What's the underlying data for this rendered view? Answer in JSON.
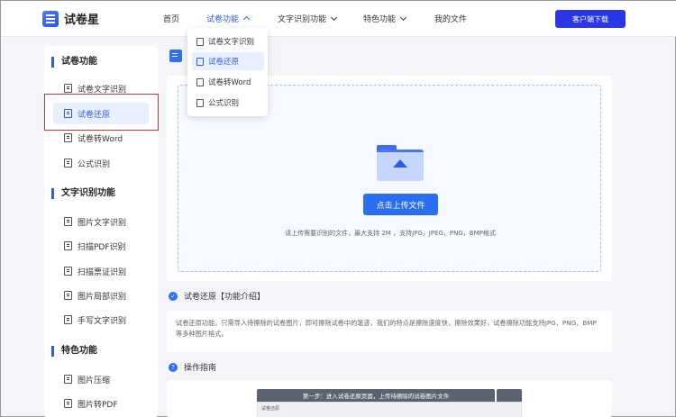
{
  "header": {
    "logo_text": "试卷星",
    "nav": [
      {
        "label": "首页",
        "active": false,
        "chevron": "none"
      },
      {
        "label": "试卷功能",
        "active": true,
        "chevron": "up"
      },
      {
        "label": "文字识别功能",
        "active": false,
        "chevron": "down"
      },
      {
        "label": "特色功能",
        "active": false,
        "chevron": "down"
      },
      {
        "label": "我的文件",
        "active": false,
        "chevron": "none"
      }
    ],
    "download_label": "客户端下载"
  },
  "dropdown": {
    "items": [
      {
        "label": "试卷文字识别",
        "selected": false
      },
      {
        "label": "试卷还原",
        "selected": true
      },
      {
        "label": "试卷转Word",
        "selected": false
      },
      {
        "label": "公式识别",
        "selected": false
      }
    ]
  },
  "sidebar": {
    "sections": [
      {
        "title": "试卷功能",
        "items": [
          {
            "label": "试卷文字识别",
            "selected": false
          },
          {
            "label": "试卷还原",
            "selected": true
          },
          {
            "label": "试卷转Word",
            "selected": false
          },
          {
            "label": "公式识别",
            "selected": false
          }
        ]
      },
      {
        "title": "文字识别功能",
        "items": [
          {
            "label": "图片文字识别",
            "selected": false
          },
          {
            "label": "扫描PDF识别",
            "selected": false
          },
          {
            "label": "扫描票证识别",
            "selected": false
          },
          {
            "label": "图片局部识别",
            "selected": false
          },
          {
            "label": "手写文字识别",
            "selected": false
          }
        ]
      },
      {
        "title": "特色功能",
        "items": [
          {
            "label": "图片压缩",
            "selected": false
          },
          {
            "label": "图片转PDF",
            "selected": false
          }
        ]
      }
    ]
  },
  "upload": {
    "button_label": "点击上传文件",
    "hint": "请上传需要识别的文件，最大支持 2M ，支持JPG，JPEG，PNG，BMP格式"
  },
  "intro": {
    "title": "试卷还原【功能介绍】",
    "text": "试卷还原功能，只需导入待擦除的试卷图片，即可擦除试卷中的笔迹，我们的特点是擦除速度快，擦除效果好，试卷擦除功能支持JPG，PNG，BMP等多种图片格式。"
  },
  "guide": {
    "title": "操作指南",
    "step_label": "第一步：进入试卷还原页面，上传待擦除的试卷图片文件",
    "shot_label": "试卷还原"
  },
  "colors": {
    "accent": "#2f5bea",
    "download_button": "#2a36e8",
    "upload_button": "#2a6ff2",
    "highlight_border": "#d93030"
  }
}
